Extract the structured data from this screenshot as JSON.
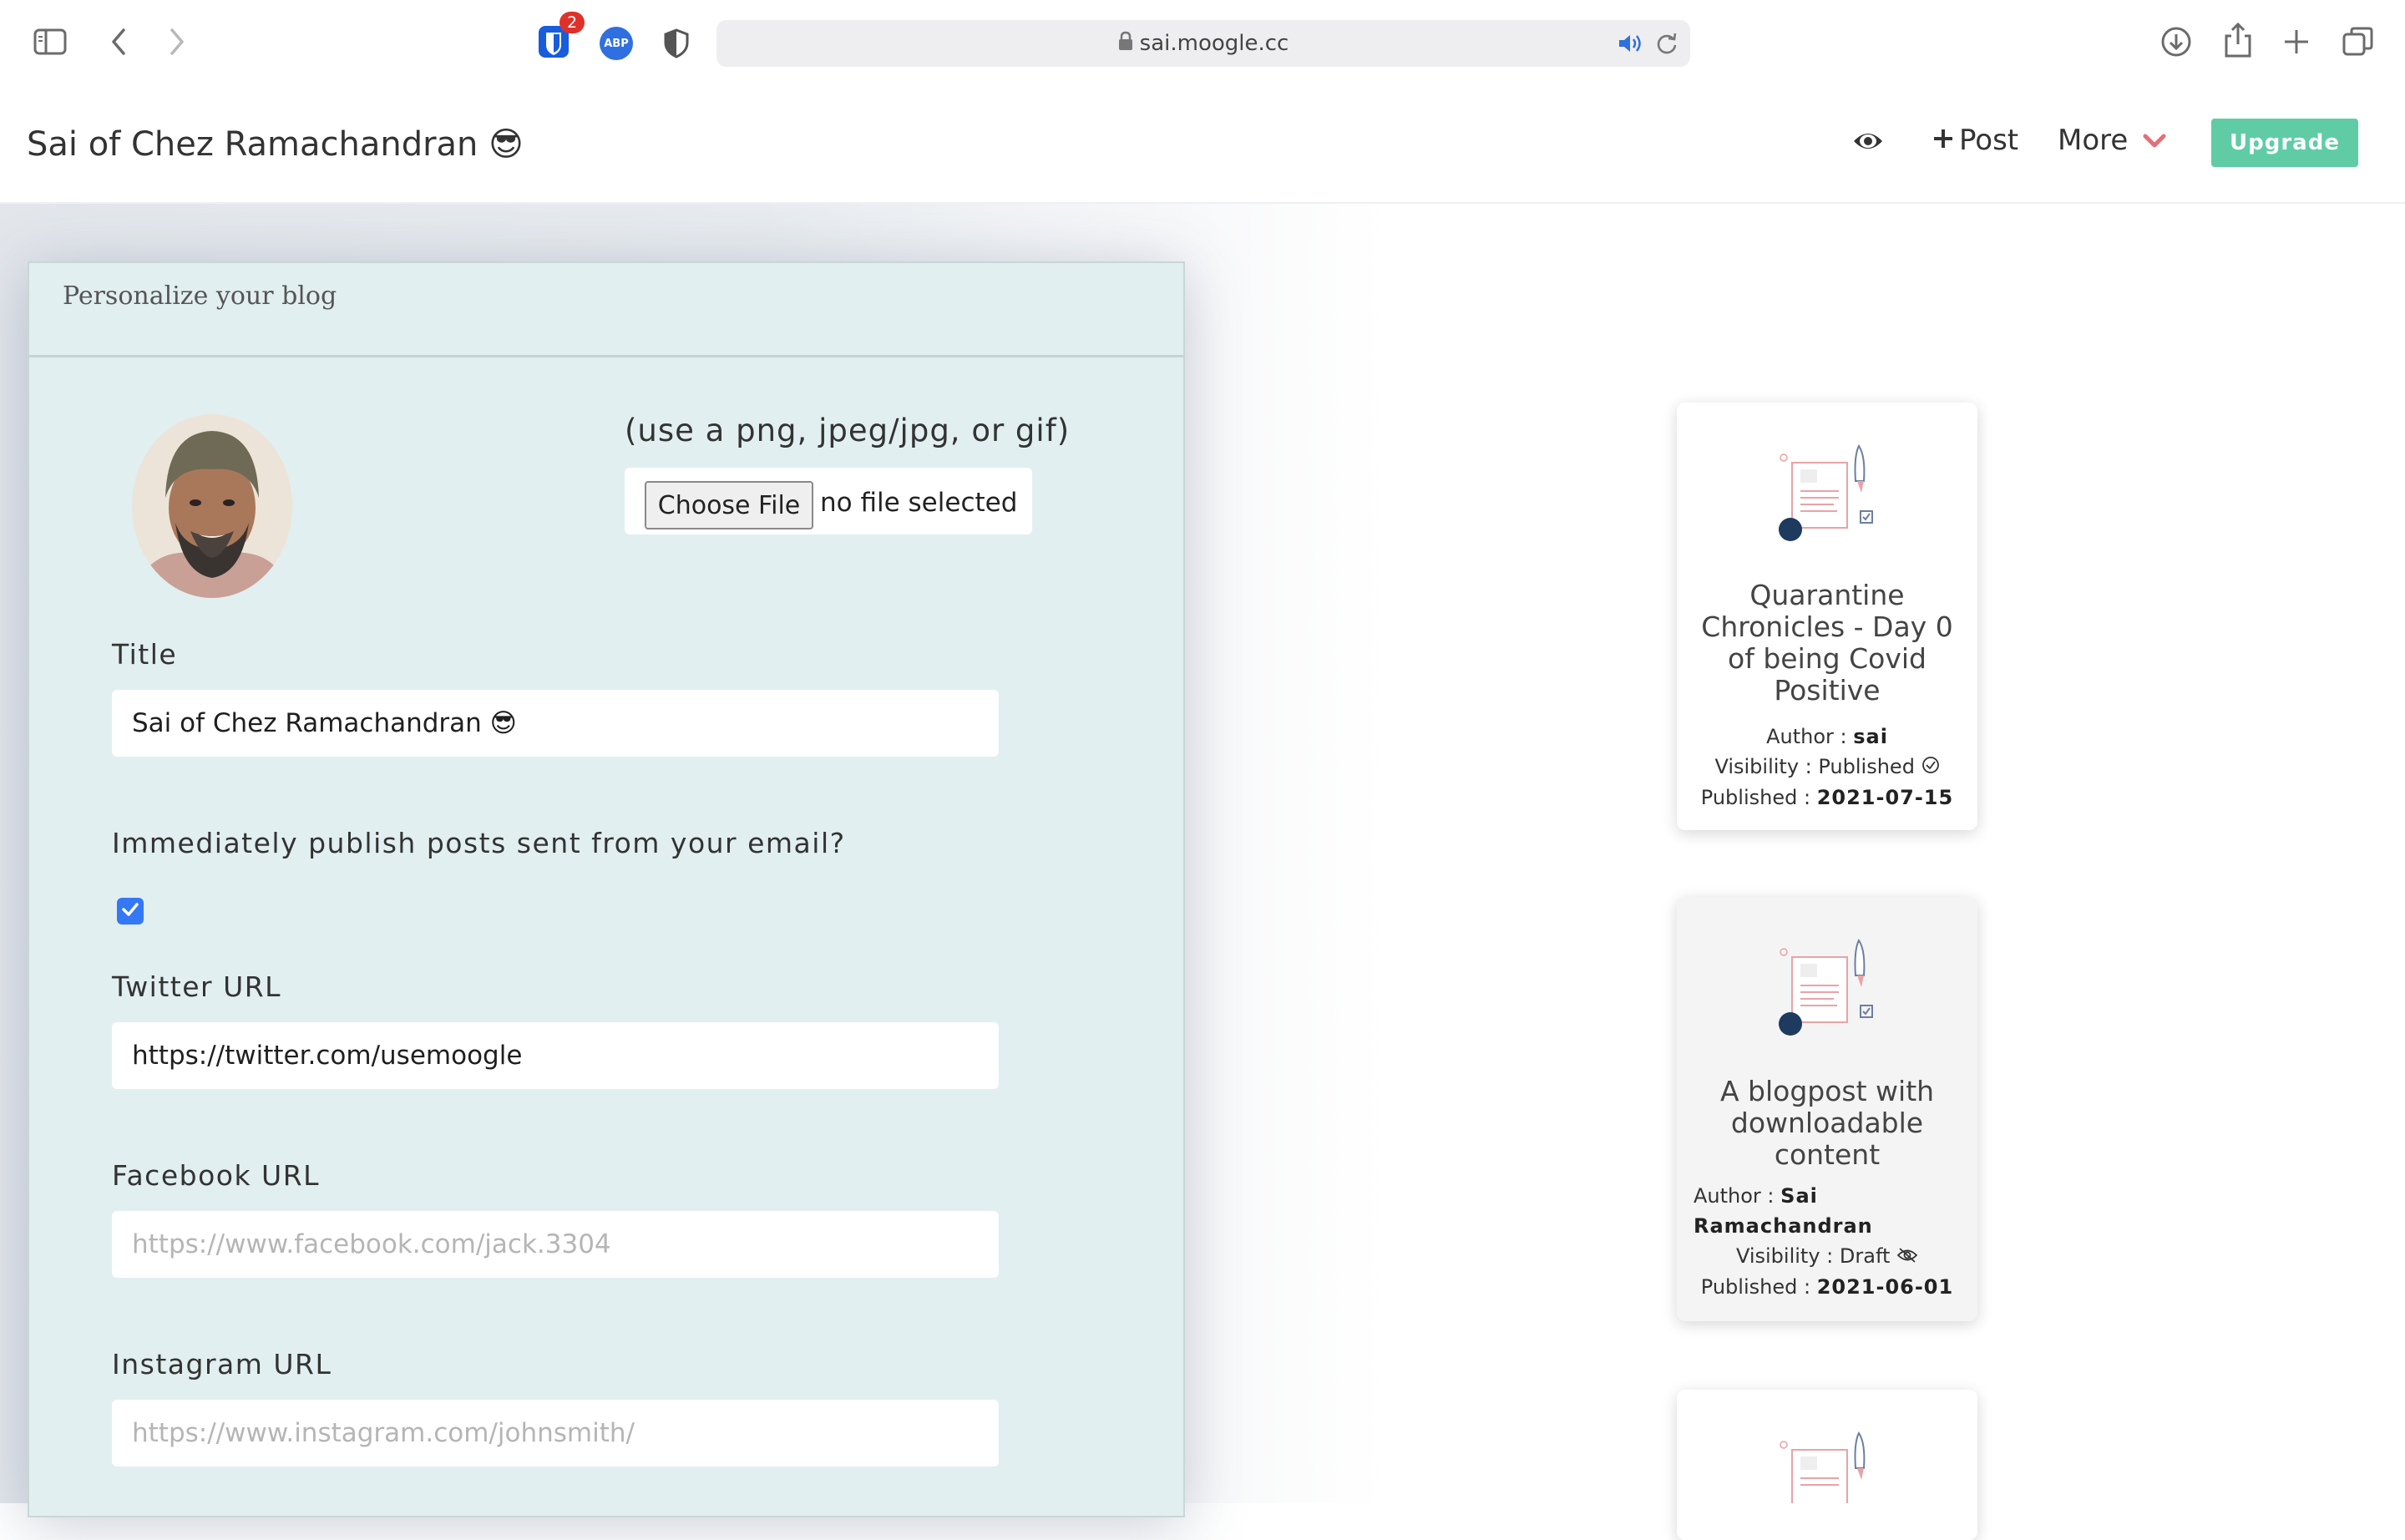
{
  "browser": {
    "url": "sai.moogle.cc",
    "extension_badge": "2",
    "abp_label": "ABP"
  },
  "header": {
    "blog_title": "Sai of Chez Ramachandran 😎",
    "post_label": "Post",
    "more_label": "More",
    "upgrade_label": "Upgrade"
  },
  "panel": {
    "title": "Personalize your blog",
    "file_hint": "(use a png, jpeg/jpg, or gif)",
    "choose_file_label": "Choose File",
    "no_file_label": "no file selected",
    "title_label": "Title",
    "title_value": "Sai of Chez Ramachandran 😎",
    "email_publish_label": "Immediately publish posts sent from your email?",
    "email_publish_checked": true,
    "twitter_label": "Twitter URL",
    "twitter_value": "https://twitter.com/usemoogle",
    "facebook_label": "Facebook URL",
    "facebook_placeholder": "https://www.facebook.com/jack.3304",
    "instagram_label": "Instagram URL",
    "instagram_placeholder": "https://www.instagram.com/johnsmith/"
  },
  "posts": [
    {
      "title_lines": [
        "Quarantine",
        "Chronicles - Day 0",
        "of being Covid",
        "Positive"
      ],
      "author_prefix": "Author : ",
      "author": "sai",
      "visibility_prefix": "Visibility : ",
      "visibility": "Published",
      "published_prefix": "Published : ",
      "published": "2021-07-15"
    },
    {
      "title_lines": [
        "A blogpost with",
        "downloadable",
        "content"
      ],
      "author_prefix": "Author : ",
      "author_line1": "Sai",
      "author_line2": "Ramachandran",
      "visibility_prefix": "Visibility : ",
      "visibility": "Draft",
      "published_prefix": "Published : ",
      "published": "2021-06-01"
    }
  ],
  "colors": {
    "upgrade": "#5fcca5",
    "panel_bg": "#e2eff0",
    "checkbox": "#3478f6",
    "more_chevron": "#e0707a"
  }
}
